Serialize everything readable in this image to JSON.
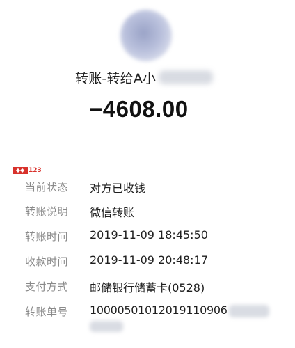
{
  "header": {
    "title": "转账-转给A小",
    "amount": "−4608.00"
  },
  "watermark": {
    "text": "123",
    "color": "#d8322c"
  },
  "details": {
    "rows": [
      {
        "label": "当前状态",
        "value": "对方已收钱"
      },
      {
        "label": "转账说明",
        "value": "微信转账"
      },
      {
        "label": "转账时间",
        "value": "2019-11-09 18:45:50"
      },
      {
        "label": "收款时间",
        "value": "2019-11-09 20:48:17"
      },
      {
        "label": "支付方式",
        "value": "邮储银行储蓄卡(0528)"
      },
      {
        "label": "转账单号",
        "value": "10000501012019110906"
      }
    ]
  }
}
